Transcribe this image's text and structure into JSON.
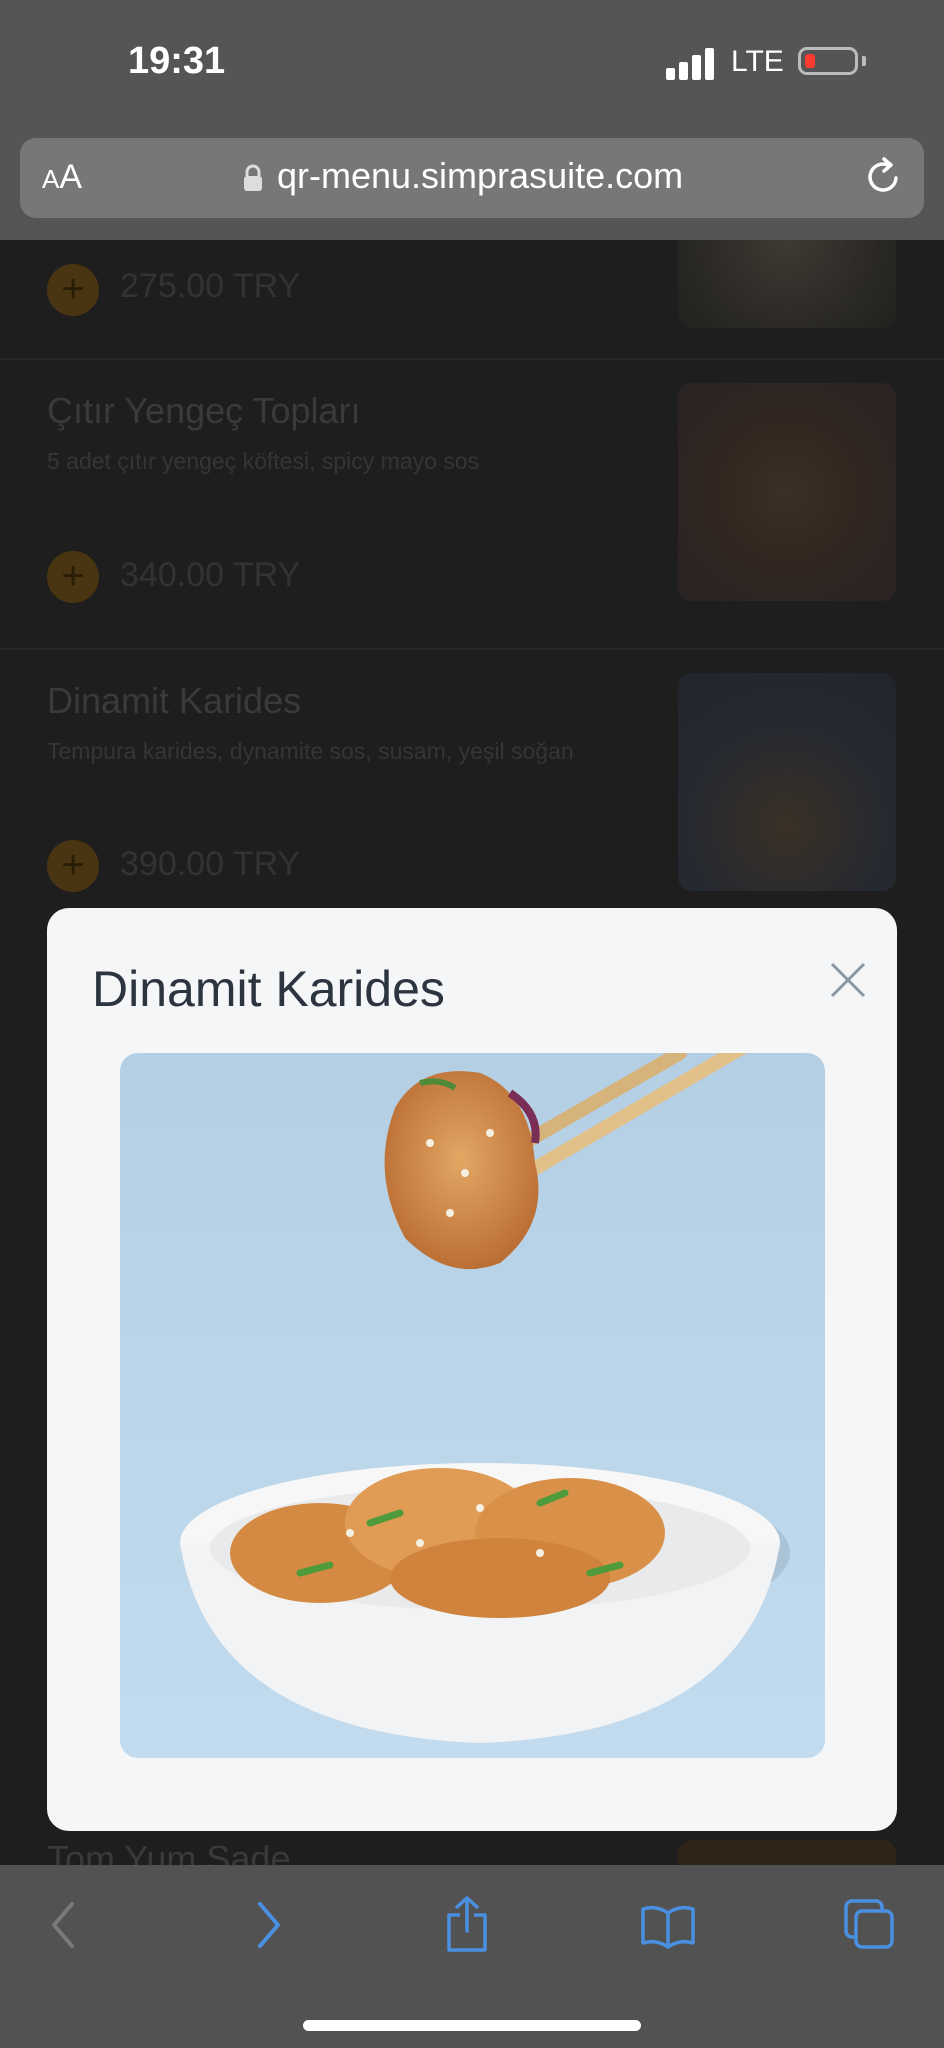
{
  "status": {
    "time": "19:31",
    "network": "LTE"
  },
  "browser": {
    "text_size_small": "A",
    "text_size_large": "A",
    "url": "qr-menu.simprasuite.com"
  },
  "menu": {
    "items": [
      {
        "title": "",
        "description": "",
        "price": "275.00 TRY"
      },
      {
        "title": "Çıtır Yengeç Topları",
        "description": "5 adet çıtır yengeç köftesi, spicy mayo sos",
        "price": "340.00 TRY"
      },
      {
        "title": "Dinamit Karides",
        "description": "Tempura karides, dynamite sos, susam, yeşil soğan",
        "price": "390.00 TRY"
      },
      {
        "title": "Tom Yum Sade",
        "description": "",
        "price": ""
      }
    ],
    "plus_symbol": "+"
  },
  "modal": {
    "title": "Dinamit Karides"
  },
  "colors": {
    "accent": "#f5a623",
    "toolbar_icon": "#4a90e2",
    "modal_bg": "#f5f6f7"
  }
}
